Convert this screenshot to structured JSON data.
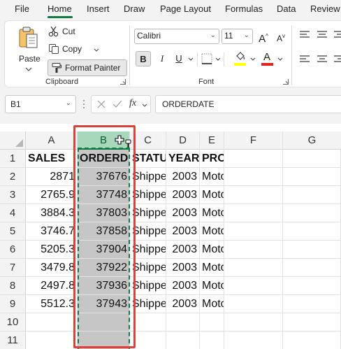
{
  "menu": {
    "tabs": [
      "File",
      "Home",
      "Insert",
      "Draw",
      "Page Layout",
      "Formulas",
      "Data",
      "Review"
    ],
    "active": "Home"
  },
  "ribbon": {
    "clipboard": {
      "paste": "Paste",
      "cut": "Cut",
      "copy": "Copy",
      "format_painter": "Format Painter",
      "label": "Clipboard"
    },
    "font": {
      "name": "Calibri",
      "size": "11",
      "bold": "B",
      "italic": "I",
      "underline": "U",
      "grow": "A",
      "shrink": "A",
      "font_color_letter": "A",
      "fill_color": "#ffff00",
      "font_color": "#e02424",
      "label": "Font"
    }
  },
  "formula_bar": {
    "name_box": "B1",
    "fx": "fx",
    "content": "ORDERDATE"
  },
  "sheet": {
    "columns": [
      "A",
      "B",
      "C",
      "D",
      "E",
      "F",
      "G"
    ],
    "selected_column": "B",
    "rows": [
      "1",
      "2",
      "3",
      "4",
      "5",
      "6",
      "7",
      "8",
      "9",
      "10",
      "11"
    ],
    "cells": [
      [
        "SALES",
        "ORDERD",
        "STATU",
        "YEAR_",
        "PRODUCTLINE"
      ],
      [
        "2871",
        "37676",
        "Shippe",
        "2003",
        "Motorcycles"
      ],
      [
        "2765.9",
        "37748",
        "Shippe",
        "2003",
        "Motorcycles"
      ],
      [
        "3884.3",
        "37803",
        "Shippe",
        "2003",
        "Motorcycles"
      ],
      [
        "3746.7",
        "37858",
        "Shippe",
        "2003",
        "Motorcycles"
      ],
      [
        "5205.3",
        "37904",
        "Shippe",
        "2003",
        "Motorcycles"
      ],
      [
        "3479.8",
        "37922",
        "Shippe",
        "2003",
        "Motorcycles"
      ],
      [
        "2497.8",
        "37936",
        "Shippe",
        "2003",
        "Motorcycles"
      ],
      [
        "5512.3",
        "37943",
        "Shippe",
        "2003",
        "Motorcycles"
      ]
    ],
    "accent_color": "#107c41",
    "highlight_color": "#e0403c"
  }
}
